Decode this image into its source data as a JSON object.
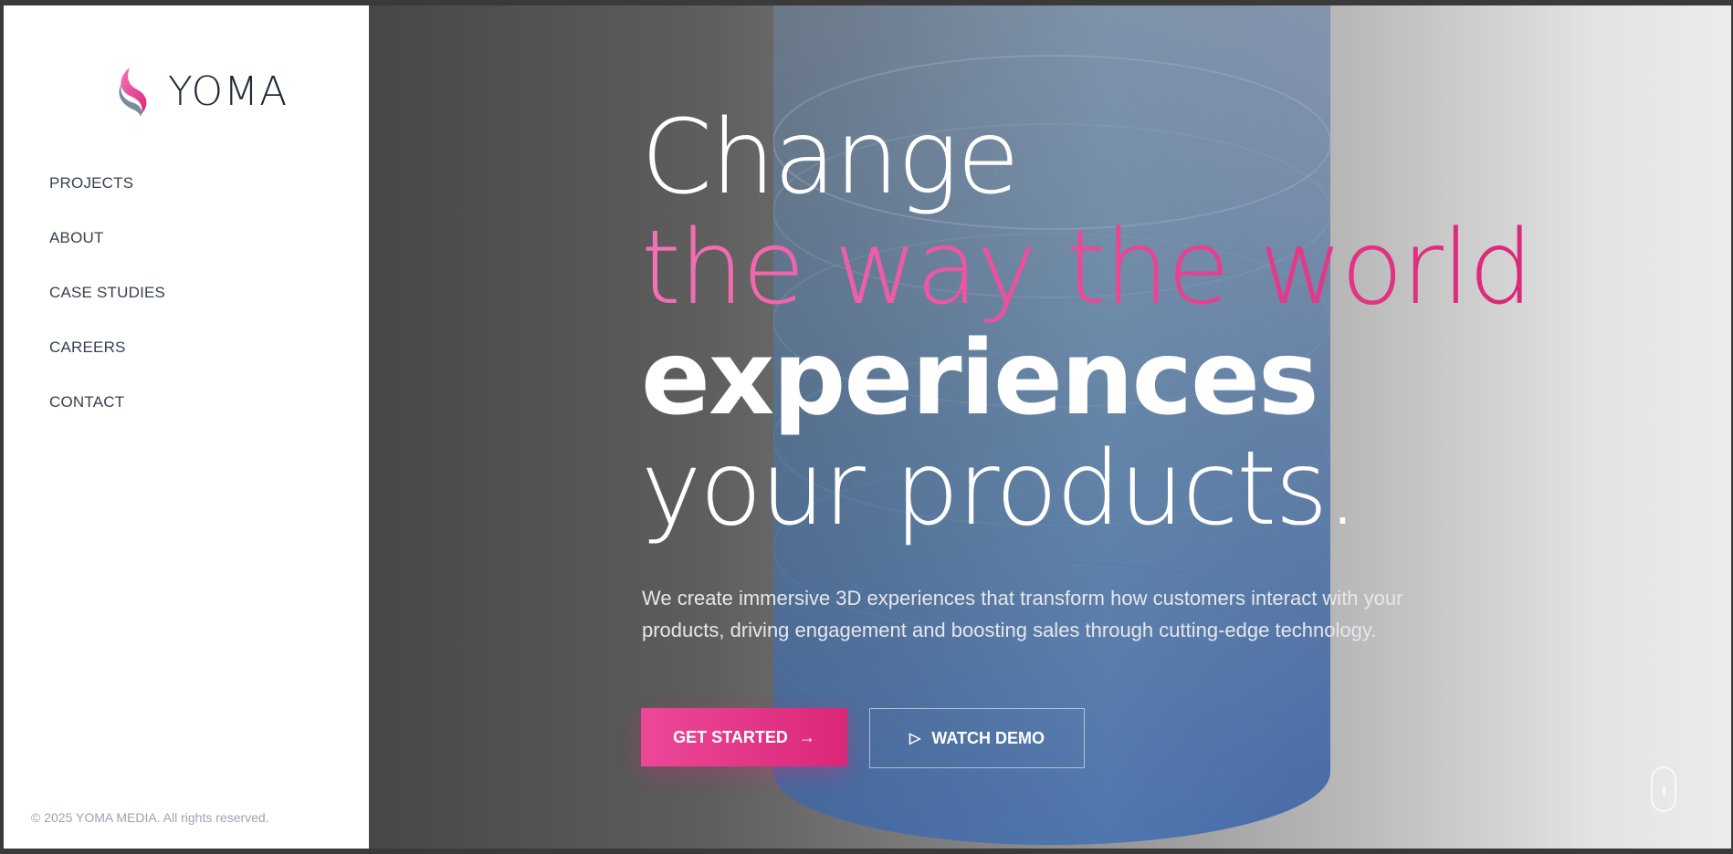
{
  "brand": {
    "name": "YOMA",
    "logo_icon": "wave-logo-icon"
  },
  "nav": {
    "items": [
      {
        "label": "PROJECTS"
      },
      {
        "label": "ABOUT"
      },
      {
        "label": "CASE STUDIES"
      },
      {
        "label": "CAREERS"
      },
      {
        "label": "CONTACT"
      }
    ]
  },
  "footer": {
    "copyright": "© 2025 YOMA MEDIA. All rights reserved."
  },
  "hero": {
    "line1": "Change",
    "line2": "the way the world",
    "line3": "experiences",
    "line4": "your products.",
    "description": "We create immersive 3D experiences that transform how customers interact with your products, driving engagement and boosting sales through cutting-edge technology.",
    "primary_cta": "GET STARTED",
    "primary_cta_icon": "arrow-right-icon",
    "secondary_cta": "WATCH DEMO",
    "secondary_cta_icon": "play-icon",
    "scroll_icon": "mouse-scroll-icon"
  },
  "colors": {
    "accent": "#ec4899",
    "accent_dark": "#db2777",
    "text_dark": "#1f2937"
  }
}
